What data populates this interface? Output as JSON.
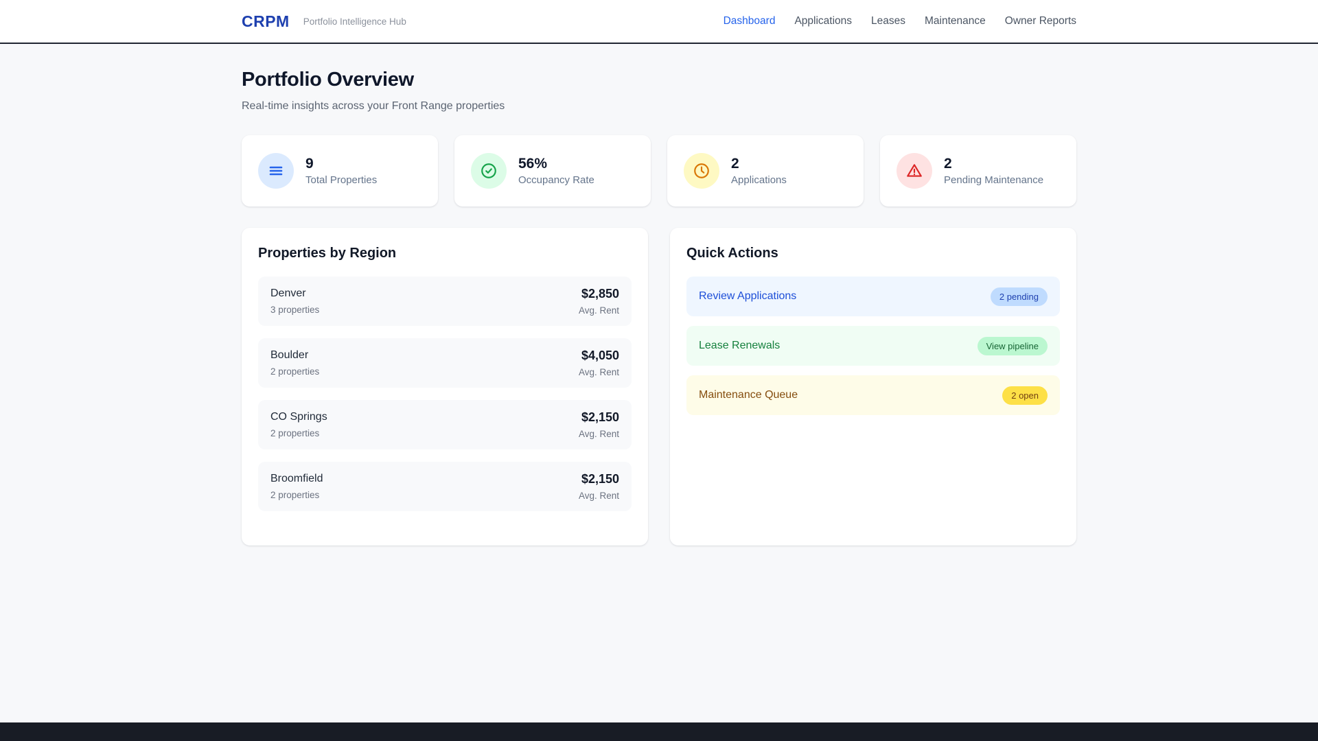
{
  "header": {
    "logo": "CRPM",
    "tagline": "Portfolio Intelligence Hub",
    "nav": [
      {
        "label": "Dashboard",
        "active": true
      },
      {
        "label": "Applications",
        "active": false
      },
      {
        "label": "Leases",
        "active": false
      },
      {
        "label": "Maintenance",
        "active": false
      },
      {
        "label": "Owner Reports",
        "active": false
      }
    ]
  },
  "page": {
    "title": "Portfolio Overview",
    "subtitle": "Real-time insights across your Front Range properties"
  },
  "stats": [
    {
      "value": "9",
      "label": "Total Properties",
      "icon": "menu-icon",
      "accent": "#2563eb",
      "icon_bg": "#dbeafe"
    },
    {
      "value": "56%",
      "label": "Occupancy Rate",
      "icon": "check-circle-icon",
      "accent": "#16a34a",
      "icon_bg": "#dcfce7"
    },
    {
      "value": "2",
      "label": "Applications",
      "icon": "clock-icon",
      "accent": "#d97706",
      "icon_bg": "#fef9c3"
    },
    {
      "value": "2",
      "label": "Pending Maintenance",
      "icon": "alert-triangle-icon",
      "accent": "#dc2626",
      "icon_bg": "#fee2e2"
    }
  ],
  "regions": {
    "title": "Properties by Region",
    "rent_label": "Avg. Rent",
    "rows": [
      {
        "name": "Denver",
        "count": "3 properties",
        "rent": "$2,850"
      },
      {
        "name": "Boulder",
        "count": "2 properties",
        "rent": "$4,050"
      },
      {
        "name": "CO Springs",
        "count": "2 properties",
        "rent": "$2,150"
      },
      {
        "name": "Broomfield",
        "count": "2 properties",
        "rent": "$2,150"
      }
    ]
  },
  "quick_actions": {
    "title": "Quick Actions",
    "items": [
      {
        "label": "Review Applications",
        "badge": "2 pending",
        "row_bg": "#eff6ff",
        "label_color": "#1d4ed8",
        "badge_bg": "#bfdbfe",
        "badge_color": "#1e40af"
      },
      {
        "label": "Lease Renewals",
        "badge": "View pipeline",
        "row_bg": "#f0fdf4",
        "label_color": "#15803d",
        "badge_bg": "#bbf7d0",
        "badge_color": "#166534"
      },
      {
        "label": "Maintenance Queue",
        "badge": "2 open",
        "row_bg": "#fefce8",
        "label_color": "#854d0e",
        "badge_bg": "#fde047",
        "badge_color": "#713f12"
      }
    ]
  },
  "theme": {
    "logo_blue": "#1e40af",
    "nav_active_blue": "#2563eb",
    "page_bg": "#f7f8fa",
    "header_border": "#1f2430",
    "taskbar_bg": "#181c25"
  }
}
